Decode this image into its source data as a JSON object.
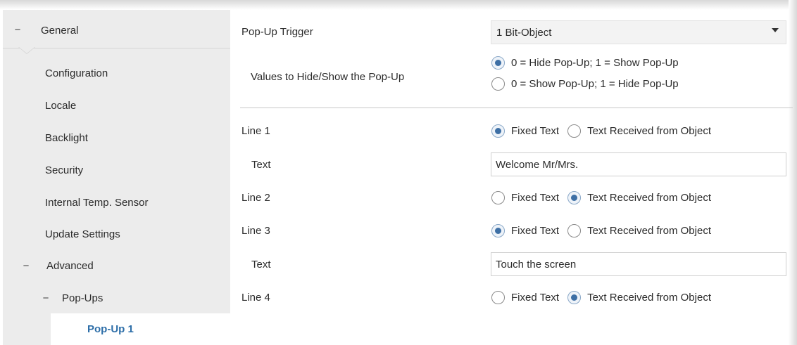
{
  "sidebar": {
    "general": "General",
    "items": [
      {
        "label": "Configuration"
      },
      {
        "label": "Locale"
      },
      {
        "label": "Backlight"
      },
      {
        "label": "Security"
      },
      {
        "label": "Internal Temp. Sensor"
      },
      {
        "label": "Update Settings"
      }
    ],
    "advanced": "Advanced",
    "popups": "Pop-Ups",
    "selected": "Pop-Up 1",
    "collapse_glyph": "−"
  },
  "main": {
    "trigger": {
      "label": "Pop-Up Trigger",
      "value": "1 Bit-Object"
    },
    "values": {
      "label": "Values to Hide/Show the Pop-Up",
      "options": [
        "0 = Hide Pop-Up; 1 = Show Pop-Up",
        "0 = Show Pop-Up; 1 = Hide Pop-Up"
      ],
      "selected": 0
    },
    "radio_options": [
      "Fixed Text",
      "Text Received from Object"
    ],
    "lines": [
      {
        "label": "Line 1",
        "selected": "Fixed Text",
        "text_label": "Text",
        "text": "Welcome Mr/Mrs."
      },
      {
        "label": "Line 2",
        "selected": "Text Received from Object"
      },
      {
        "label": "Line 3",
        "selected": "Fixed Text",
        "text_label": "Text",
        "text": "Touch the screen"
      },
      {
        "label": "Line 4",
        "selected": "Text Received from Object"
      }
    ]
  },
  "colors": {
    "accent": "#3d6fa5",
    "selected_text": "#2d6ea8",
    "sidebar_bg": "#ececec"
  }
}
